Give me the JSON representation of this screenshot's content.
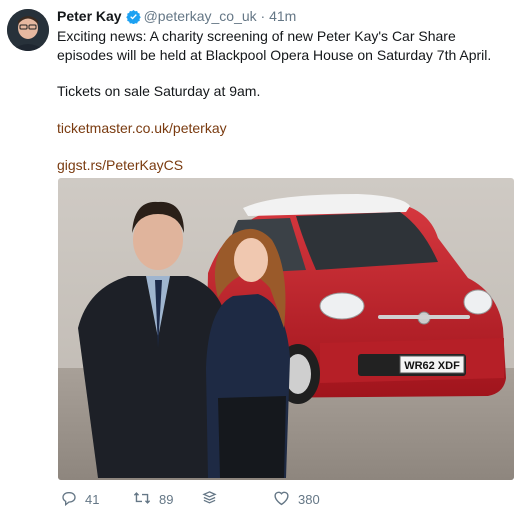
{
  "tweet": {
    "author_name": "Peter Kay",
    "handle": "@peterkay_co_uk",
    "separator": "·",
    "time": "41m",
    "text_line1": "Exciting news: A charity screening of new Peter Kay's Car Share episodes will be held at Blackpool Opera House on Saturday 7th April.",
    "text_line2": "Tickets on sale Saturday at 9am.",
    "link1": "ticketmaster.co.uk/peterkay",
    "link2": "gigst.rs/PeterKayCS",
    "license_plate": "WR62 XDF"
  },
  "actions": {
    "reply_count": "41",
    "retweet_count": "89",
    "like_count": "380"
  },
  "colors": {
    "link": "#7a3b10",
    "verified": "#1da1f2",
    "muted": "#657786"
  },
  "icons": {
    "reply": "reply-icon",
    "retweet": "retweet-icon",
    "stack": "stack-icon",
    "like": "heart-icon",
    "verified": "verified-badge-icon"
  }
}
